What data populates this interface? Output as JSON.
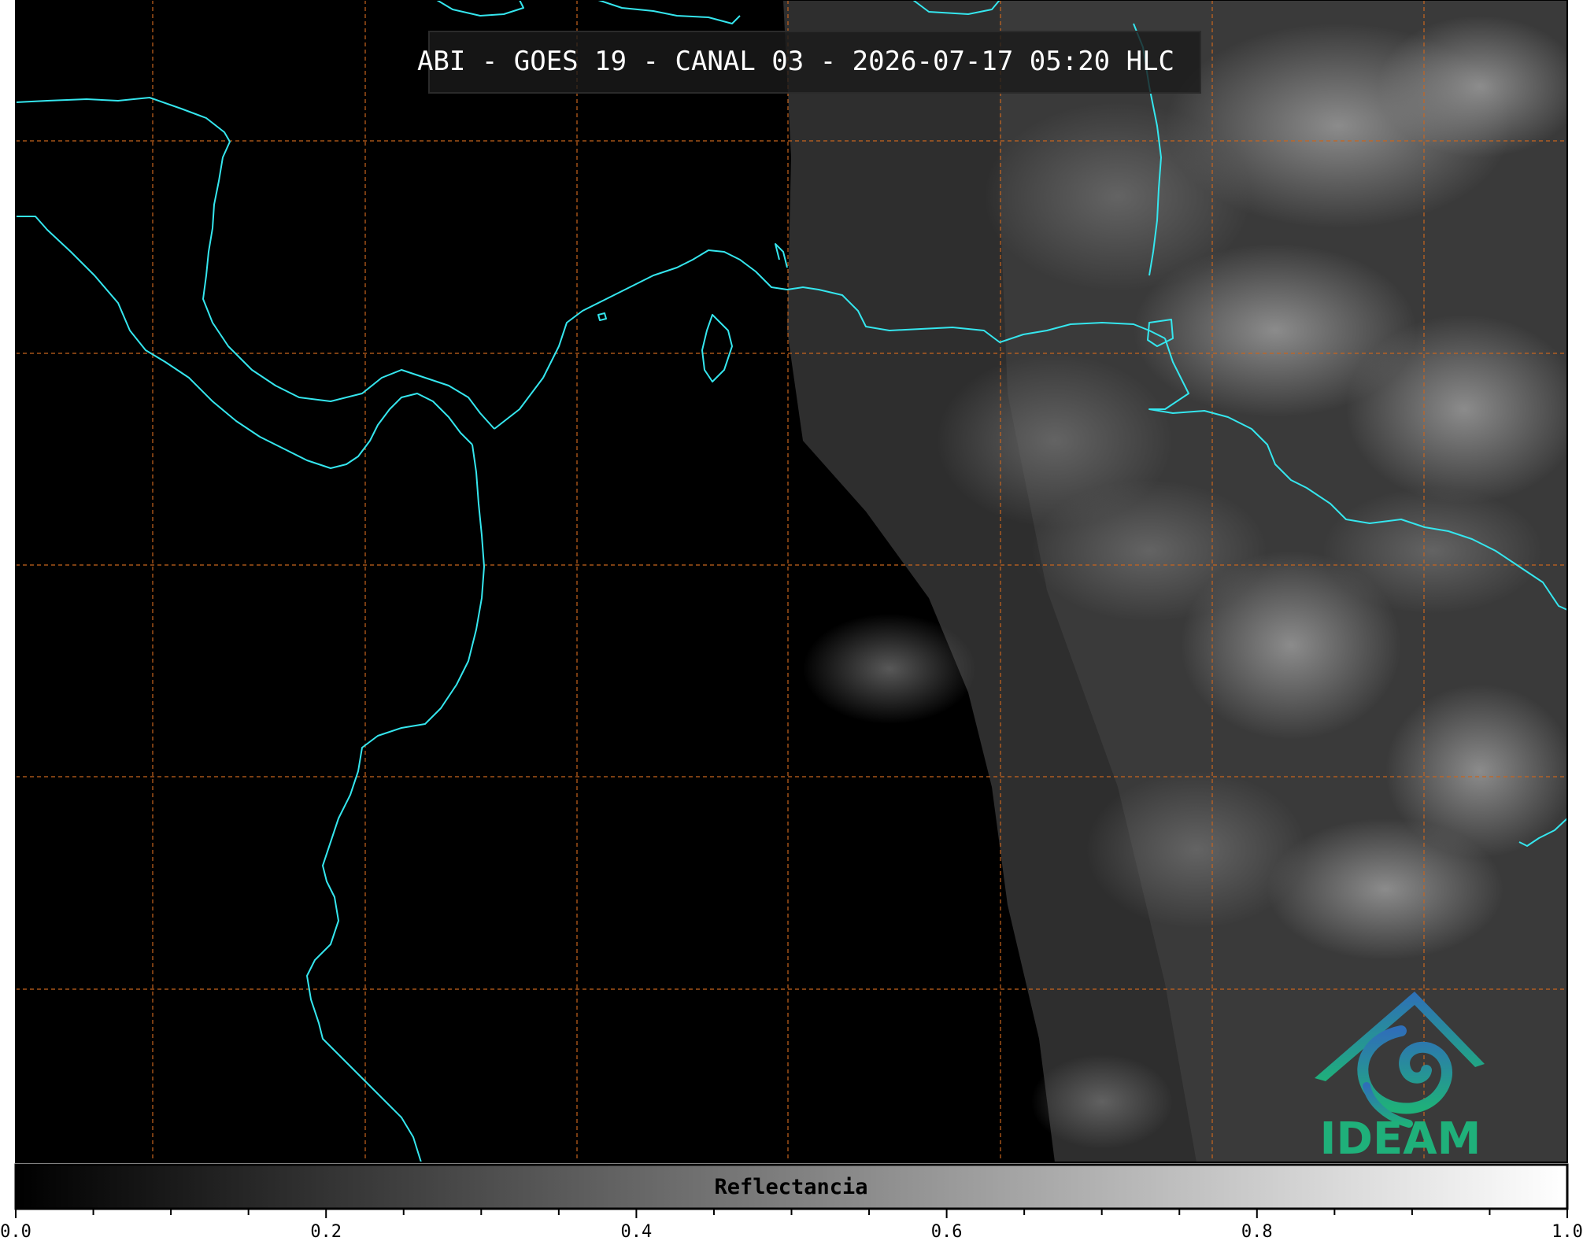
{
  "title": "ABI - GOES 19 - CANAL 03 - 2026-07-17 05:20 HLC",
  "colorbar": {
    "label": "Reflectancia",
    "min": 0.0,
    "max": 1.0,
    "tick_labels": [
      "0.0",
      "0.2",
      "0.4",
      "0.6",
      "0.8",
      "1.0"
    ],
    "major_step": 0.2,
    "minor_step": 0.05
  },
  "logo": {
    "text": "IDEAM",
    "color_top": "#2f6fb8",
    "color_bottom": "#1fb07a"
  },
  "colors": {
    "coastline": "#35e6ee",
    "gridline": "#c8651e",
    "background": "#000000"
  },
  "icons": {
    "logo": "ideam-mountain-spiral-icon"
  }
}
